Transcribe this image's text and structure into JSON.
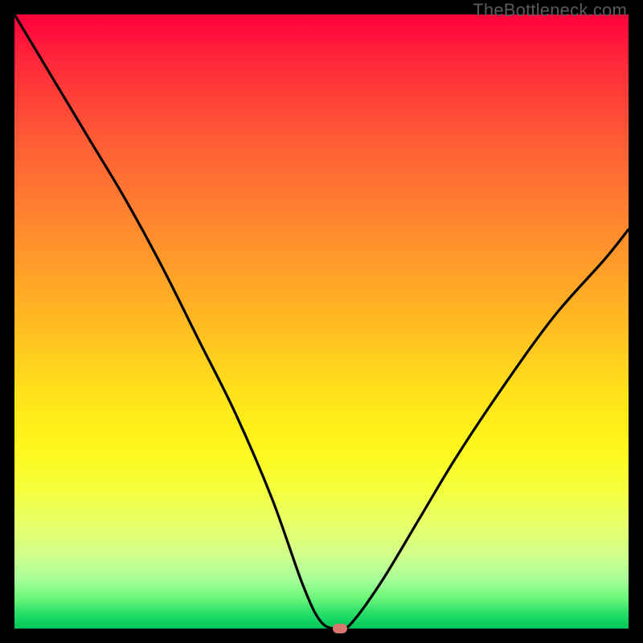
{
  "watermark": "TheBottleneck.com",
  "colors": {
    "background": "#000000",
    "curve": "#000000",
    "marker": "#d8766e"
  },
  "chart_data": {
    "type": "line",
    "title": "",
    "xlabel": "",
    "ylabel": "",
    "xlim": [
      0,
      100
    ],
    "ylim": [
      0,
      100
    ],
    "grid": false,
    "legend": false,
    "series": [
      {
        "name": "bottleneck-curve",
        "x": [
          0,
          6,
          12,
          18,
          24,
          30,
          36,
          42,
          47,
          50,
          53,
          55,
          60,
          66,
          72,
          80,
          88,
          96,
          100
        ],
        "values": [
          100,
          90,
          80,
          70,
          59,
          47,
          35,
          21,
          7,
          1,
          0,
          1,
          8,
          18,
          28,
          40,
          51,
          60,
          65
        ]
      }
    ],
    "marker": {
      "x": 53,
      "y": 0
    },
    "annotations": []
  }
}
